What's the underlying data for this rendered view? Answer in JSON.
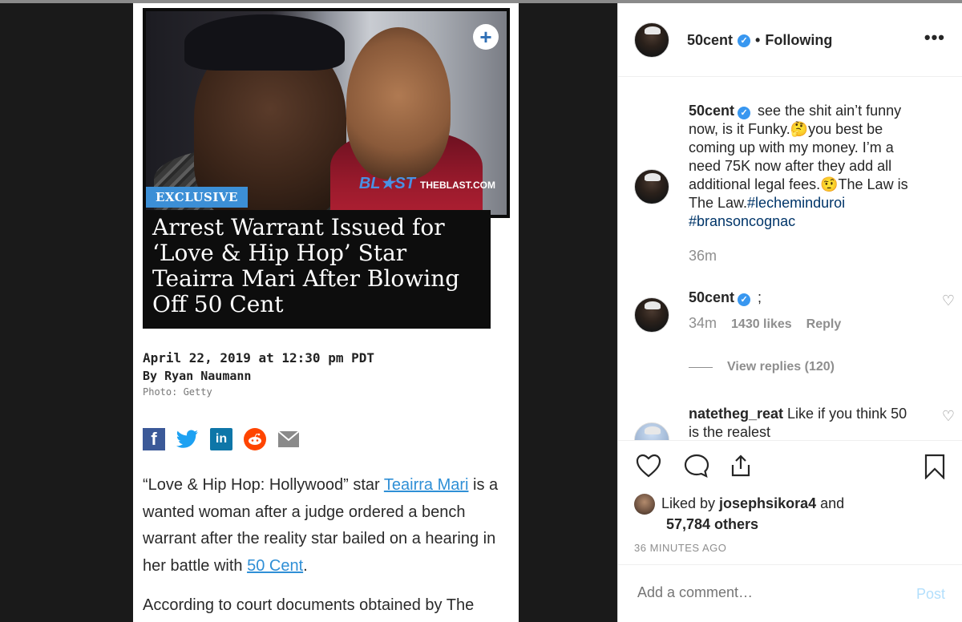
{
  "article": {
    "hero": {
      "brand": "BL★ST",
      "site": "THEBLAST.COM"
    },
    "tag": "EXCLUSIVE",
    "headline": "Arrest Warrant Issued for ‘Love & Hip Hop’ Star Teairra Mari After Blowing Off 50 Cent",
    "date": "April 22, 2019 at 12:30 pm PDT",
    "byline": "By Ryan Naumann",
    "photo_credit": "Photo: Getty",
    "share_icons": [
      "facebook-icon",
      "twitter-icon",
      "linkedin-icon",
      "reddit-icon",
      "mail-icon"
    ],
    "paragraph1": {
      "before": "“Love & Hip Hop: Hollywood” star ",
      "link1": "Teairra Mari",
      "middle": " is a wanted woman after a judge ordered a bench warrant after the reality star bailed on a hearing in her battle with ",
      "link2": "50 Cent",
      "after": "."
    },
    "paragraph2": "According to court documents obtained by The"
  },
  "post": {
    "username": "50cent",
    "dot": "•",
    "following": "Following",
    "more": "•••",
    "caption": {
      "username": "50cent",
      "text": " see the shit ain’t funny now, is it Funky.🤔you best be coming up with my money. I’m a need 75K now after they add all additional legal fees.🤨The Law is The Law.",
      "hashtags": "#lecheminduroi #bransoncognac",
      "time": "36m"
    },
    "comment1": {
      "username": "50cent",
      "text": " ;",
      "time": "34m",
      "likes": "1430 likes",
      "reply": "Reply"
    },
    "view_replies": "View replies (120)",
    "comment2": {
      "username": "natetheg_reat",
      "text": " Like if you think 50 is the realest"
    },
    "liked_by": {
      "prefix": "Liked by ",
      "user": "josephsikora4",
      "and": " and",
      "others": "57,784 others"
    },
    "ago": "36 MINUTES AGO",
    "comment_placeholder": "Add a comment…",
    "post_label": "Post"
  },
  "colors": {
    "link_blue": "#2f8fd6",
    "verified": "#3897f0",
    "tag_bg": "#3c8fd6",
    "post_disabled": "#b2dffc"
  }
}
